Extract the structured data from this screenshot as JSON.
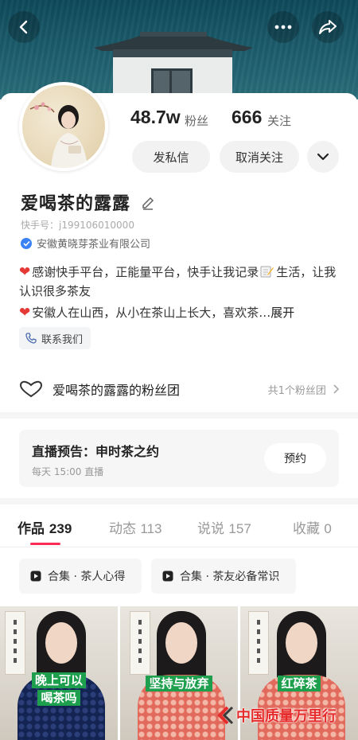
{
  "header": {
    "back_icon": "chevron-left-icon",
    "more_icon": "more-dots-icon",
    "share_icon": "share-arrow-icon"
  },
  "profile": {
    "followers_count": "48.7w",
    "followers_label": "粉丝",
    "following_count": "666",
    "following_label": "关注",
    "message_button": "发私信",
    "unfollow_button": "取消关注",
    "name": "爱喝茶的露露",
    "kuaishou_id": "快手号：j199106010000",
    "verified_company": "安徽黄晓芽茶业有限公司",
    "bio_line1": "感谢快手平台，正能量平台，快手让我记录",
    "bio_line1_end": "生活，让我认识很多茶友",
    "bio_line2": "安徽人在山西，从小在茶山上长大，喜欢茶…",
    "bio_expand": "展开",
    "contact_button": "联系我们"
  },
  "fan_group": {
    "label": "爱喝茶的露露的粉丝团",
    "count_text": "共1个粉丝团"
  },
  "live_preview": {
    "title": "直播预告：申时茶之约",
    "schedule": "每天 15:00 直播",
    "reserve_button": "预约"
  },
  "tabs": [
    {
      "label": "作品",
      "count": "239"
    },
    {
      "label": "动态",
      "count": "113"
    },
    {
      "label": "说说",
      "count": "157"
    },
    {
      "label": "收藏",
      "count": "0"
    }
  ],
  "collections": [
    {
      "label": "合集 · 茶人心得"
    },
    {
      "label": "合集 · 茶友必备常识"
    }
  ],
  "videos": [
    {
      "caption_line1": "晚上可以",
      "caption_line2": "喝茶吗"
    },
    {
      "caption_line1": "坚持与放弃",
      "caption_line2": ""
    },
    {
      "caption_line1": "红碎茶",
      "caption_line2": ""
    }
  ],
  "watermark": {
    "text": "中国质量万里行"
  },
  "colors": {
    "accent": "#fe2c55",
    "caption_green": "#1e9f4e",
    "watermark_red": "#e62b2b"
  }
}
